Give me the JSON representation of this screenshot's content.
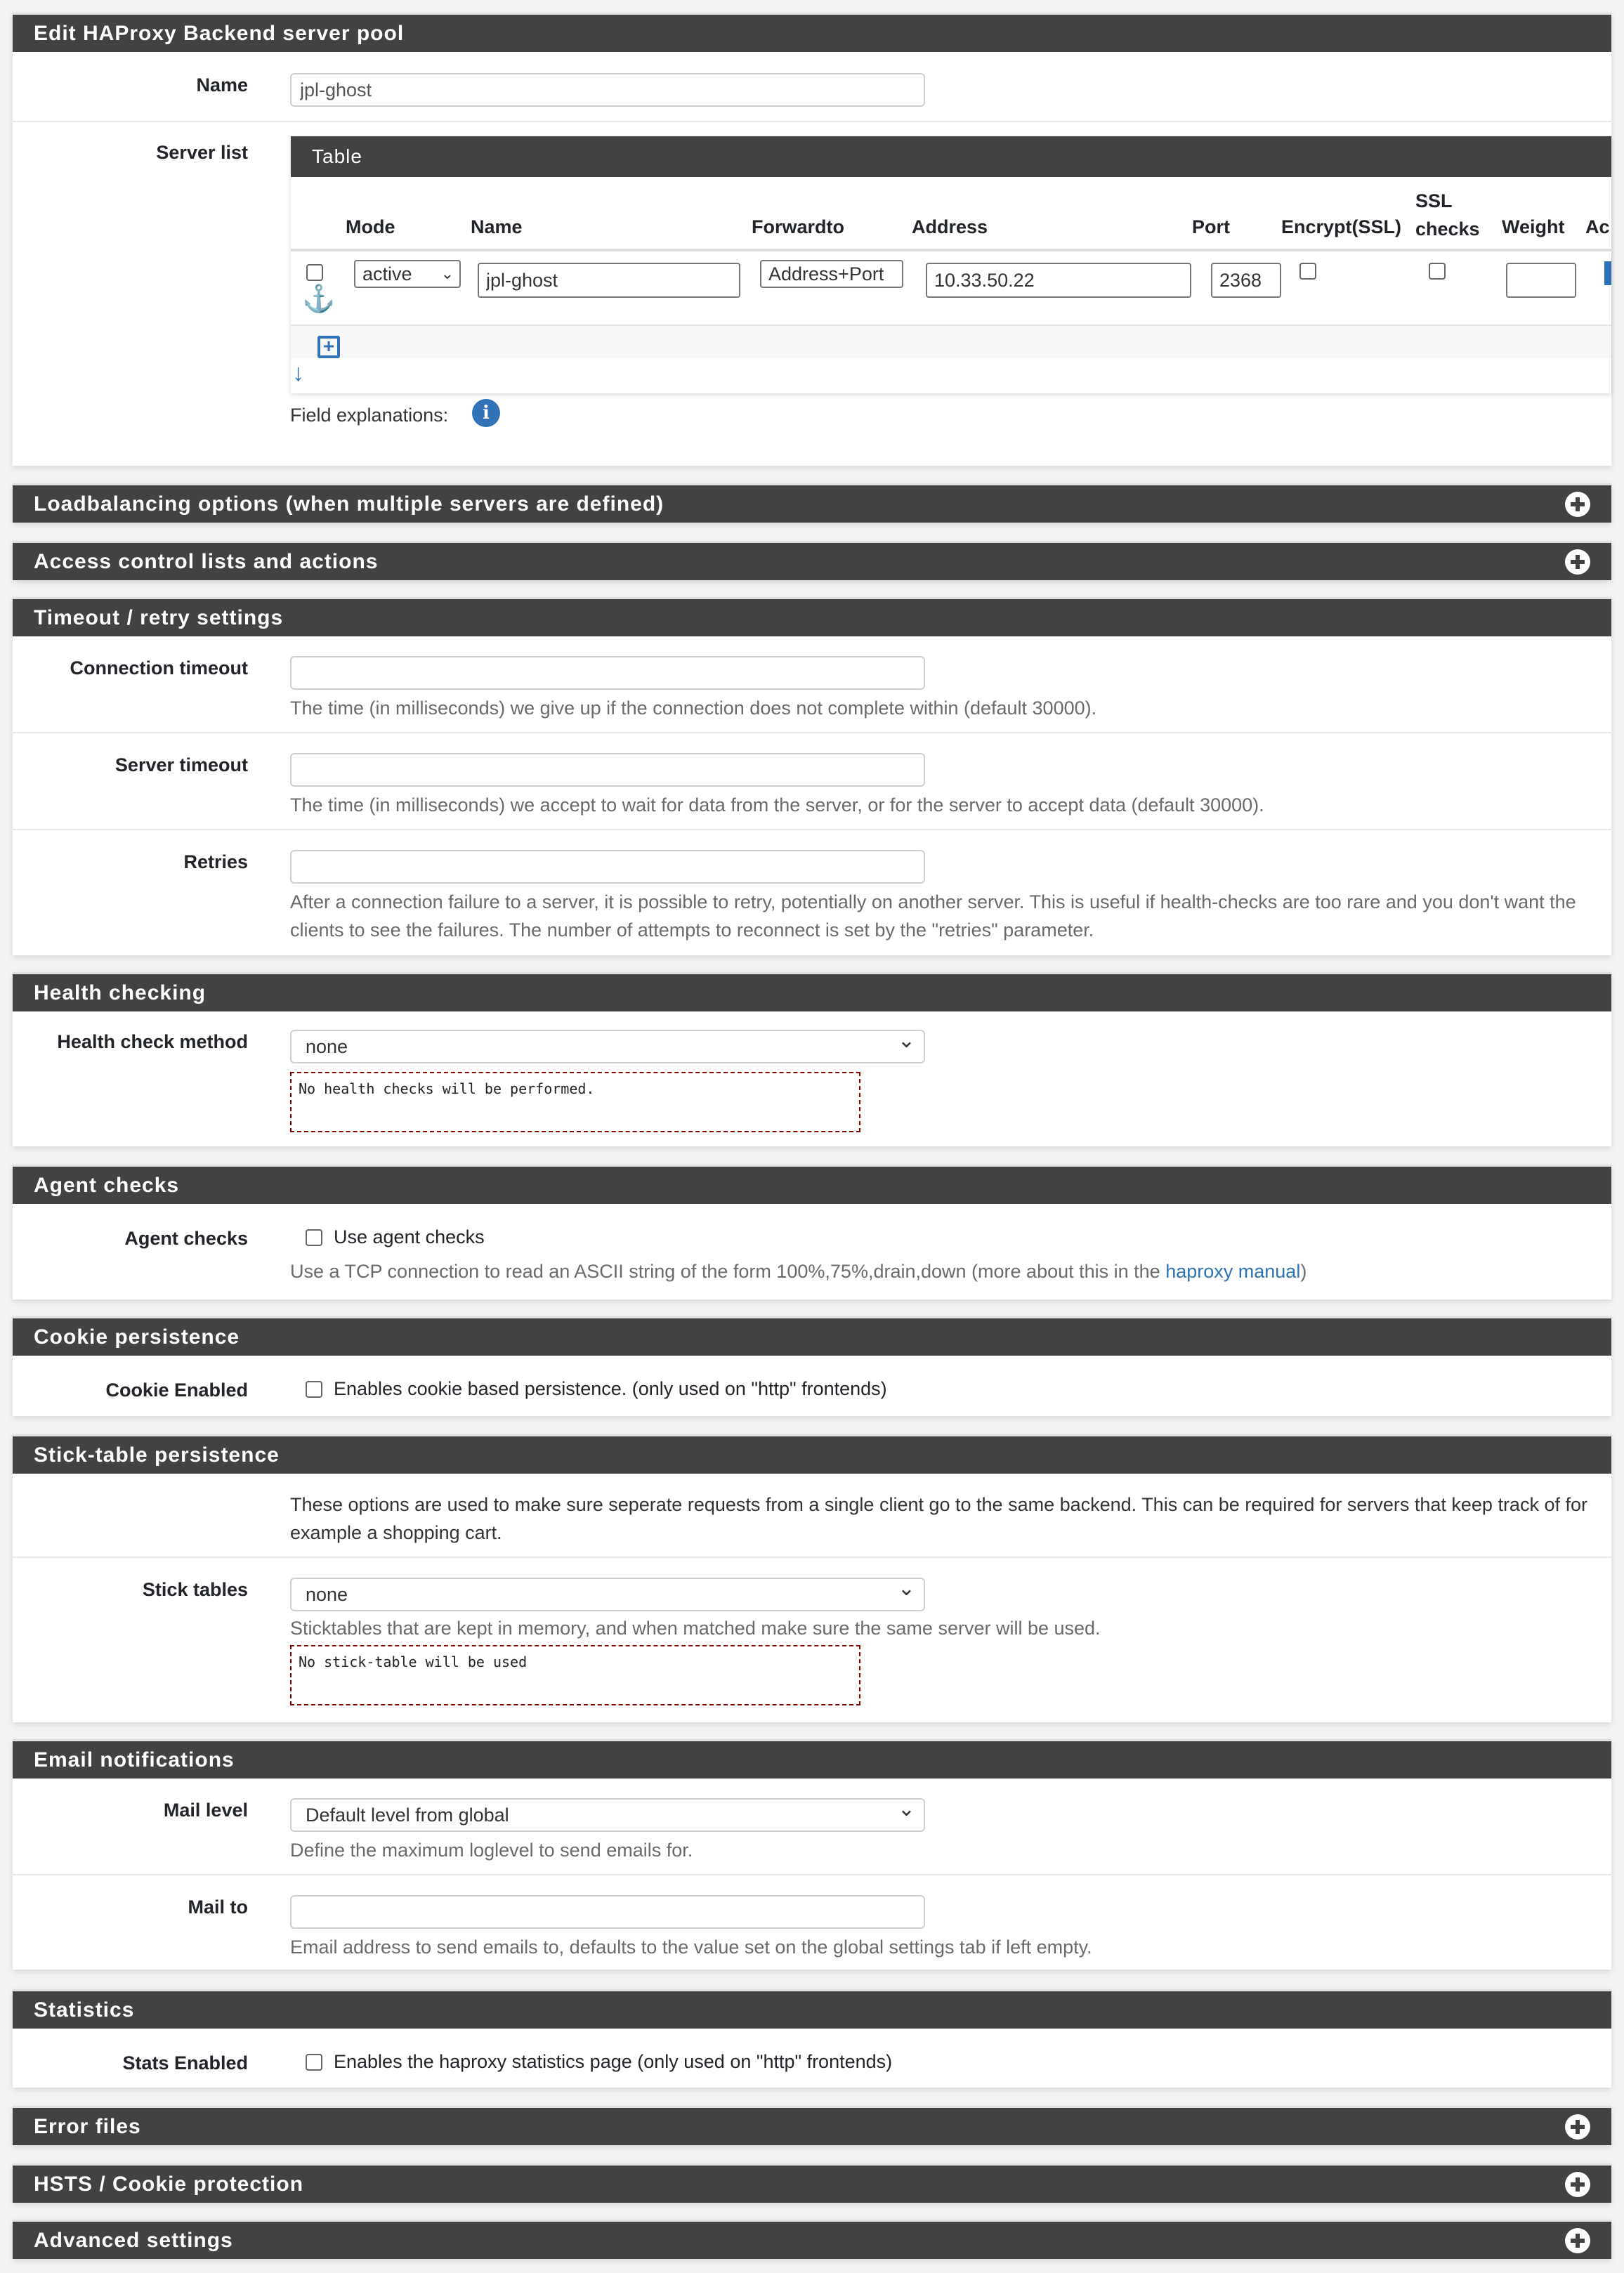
{
  "main_panel": {
    "title": "Edit HAProxy Backend server pool",
    "name_label": "Name",
    "name_value": "jpl-ghost",
    "server_list_label": "Server list",
    "table": {
      "title": "Table",
      "columns": [
        "Mode",
        "Name",
        "Forwardto",
        "Address",
        "Port",
        "Encrypt(SSL)",
        "SSL checks",
        "Weight",
        "Ac"
      ],
      "rows": [
        {
          "mode": "active",
          "name": "jpl-ghost",
          "forwardto": "Address+Port",
          "address": "10.33.50.22",
          "port": "2368",
          "encrypt_ssl": false,
          "ssl_checks": false,
          "weight": ""
        }
      ]
    },
    "field_explanations_label": "Field explanations:"
  },
  "collapsed_sections": {
    "loadbalancing": "Loadbalancing options (when multiple servers are defined)",
    "acl": "Access control lists and actions",
    "error_files": "Error files",
    "hsts": "HSTS / Cookie protection",
    "advanced": "Advanced settings"
  },
  "timeout": {
    "title": "Timeout / retry settings",
    "connection_timeout_label": "Connection timeout",
    "connection_timeout_value": "",
    "connection_timeout_help": "The time (in milliseconds) we give up if the connection does not complete within (default 30000).",
    "server_timeout_label": "Server timeout",
    "server_timeout_value": "",
    "server_timeout_help": "The time (in milliseconds) we accept to wait for data from the server, or for the server to accept data (default 30000).",
    "retries_label": "Retries",
    "retries_value": "",
    "retries_help": "After a connection failure to a server, it is possible to retry, potentially on another server. This is useful if health-checks are too rare and you don't want the clients to see the failures. The number of attempts to reconnect is set by the \"retries\" parameter."
  },
  "health": {
    "title": "Health checking",
    "method_label": "Health check method",
    "method_value": "none",
    "method_note": "No health checks will be performed."
  },
  "agent": {
    "title": "Agent checks",
    "label": "Agent checks",
    "checkbox_label": "Use agent checks",
    "checked": false,
    "help_prefix": "Use a TCP connection to read an ASCII string of the form 100%,75%,drain,down (more about this in the ",
    "help_link": "haproxy manual",
    "help_suffix": ")"
  },
  "cookie": {
    "title": "Cookie persistence",
    "label": "Cookie Enabled",
    "checkbox_label": "Enables cookie based persistence. (only used on \"http\" frontends)",
    "checked": false
  },
  "stick": {
    "title": "Stick-table persistence",
    "intro": "These options are used to make sure seperate requests from a single client go to the same backend. This can be required for servers that keep track of for example a shopping cart.",
    "label": "Stick tables",
    "value": "none",
    "help": "Sticktables that are kept in memory, and when matched make sure the same server will be used.",
    "note": "No stick-table will be used"
  },
  "email": {
    "title": "Email notifications",
    "mail_level_label": "Mail level",
    "mail_level_value": "Default level from global",
    "mail_level_help": "Define the maximum loglevel to send emails for.",
    "mail_to_label": "Mail to",
    "mail_to_value": "",
    "mail_to_help": "Email address to send emails to, defaults to the value set on the global settings tab if left empty."
  },
  "stats": {
    "title": "Statistics",
    "label": "Stats Enabled",
    "checkbox_label": "Enables the haproxy statistics page (only used on \"http\" frontends)",
    "checked": false
  },
  "colors": {
    "header_bg": "#424242",
    "accent_blue": "#2f73b6",
    "note_border": "#8b0000"
  }
}
